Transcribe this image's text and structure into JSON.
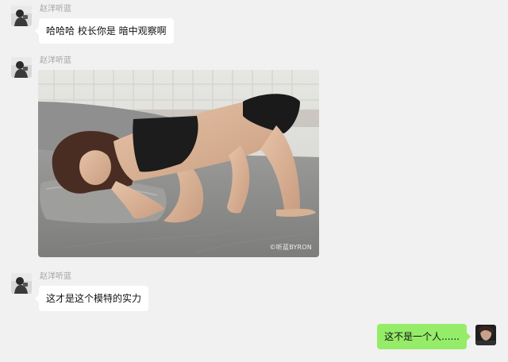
{
  "messages": [
    {
      "sender": "赵洋听蓝",
      "type": "text",
      "text": "哈哈哈 校长你是 暗中观察啊"
    },
    {
      "sender": "赵洋听蓝",
      "type": "image",
      "watermark": "©听蓝BYRON"
    },
    {
      "sender": "赵洋听蓝",
      "type": "text",
      "text": "这才是这个模特的实力"
    },
    {
      "sender": "self",
      "type": "text",
      "text": "这不是一个人......"
    }
  ],
  "colors": {
    "background": "#f1f1f1",
    "incoming_bubble": "#ffffff",
    "outgoing_bubble": "#95ec69",
    "sender_name": "#a3a3a3"
  }
}
